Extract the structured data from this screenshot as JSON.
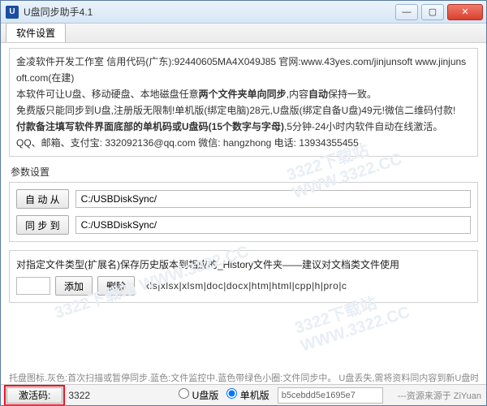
{
  "window": {
    "title": "U盘同步助手4.1",
    "icon_letter": "U"
  },
  "tabs": {
    "settings": "软件设置"
  },
  "info": {
    "line1": "金凌软件开发工作室 信用代码(广东):92440605MA4X049J85 官网:www.43yes.com/jinjunsoft www.jinjunsoft.com(在建)",
    "line2a": "本软件可让U盘、移动硬盘、本地磁盘任意",
    "line2b": "两个文件夹单向同步",
    "line2c": ",内容",
    "line2d": "自动",
    "line2e": "保持一致。",
    "line3": "免费版只能同步到U盘,注册版无限制!单机版(绑定电脑)28元,U盘版(绑定自备U盘)49元!微信二维码付款!",
    "line4a": "付款备注填写软件界面底部的单机码或U盘码(15个数字与字母)",
    "line4b": ",5分钟-24小时内软件自动在线激活。",
    "line5": "QQ、邮箱、支付宝: 332092136@qq.com   微信: hangzhong        电话: 13934355455"
  },
  "params": {
    "section_label": "参数设置",
    "auto_from_btn": "自 动 从",
    "auto_from_path": "C:/USBDiskSync/",
    "sync_to_btn": "同 步 到",
    "sync_to_path": "C:/USBDiskSync/"
  },
  "history": {
    "desc": "对指定文件类型(扩展名)保存历史版本到相应的_History文件夹——建议对文档类文件使用",
    "add_btn": "添加",
    "del_btn": "删除",
    "ext_list": "xls|xlsx|xlsm|doc|docx|htm|html|cpp|h|pro|c"
  },
  "legend": "托盘图标.灰色:首次扫描或暂停同步.蓝色:文件监控中.蓝色带绿色小圈:文件同步中。 U盘丢失,需将资料同内容到新U盘时,请先退出软件",
  "statusbar": {
    "activate_btn": "激活码:",
    "sn": "3322",
    "radio_u": "U盘版",
    "radio_pc": "单机版",
    "code_value": "b5cebdd5e1695e7",
    "credit": "---资源来源于 ZiYuan"
  },
  "watermark": "3322下载站  WWW.3322.CC"
}
